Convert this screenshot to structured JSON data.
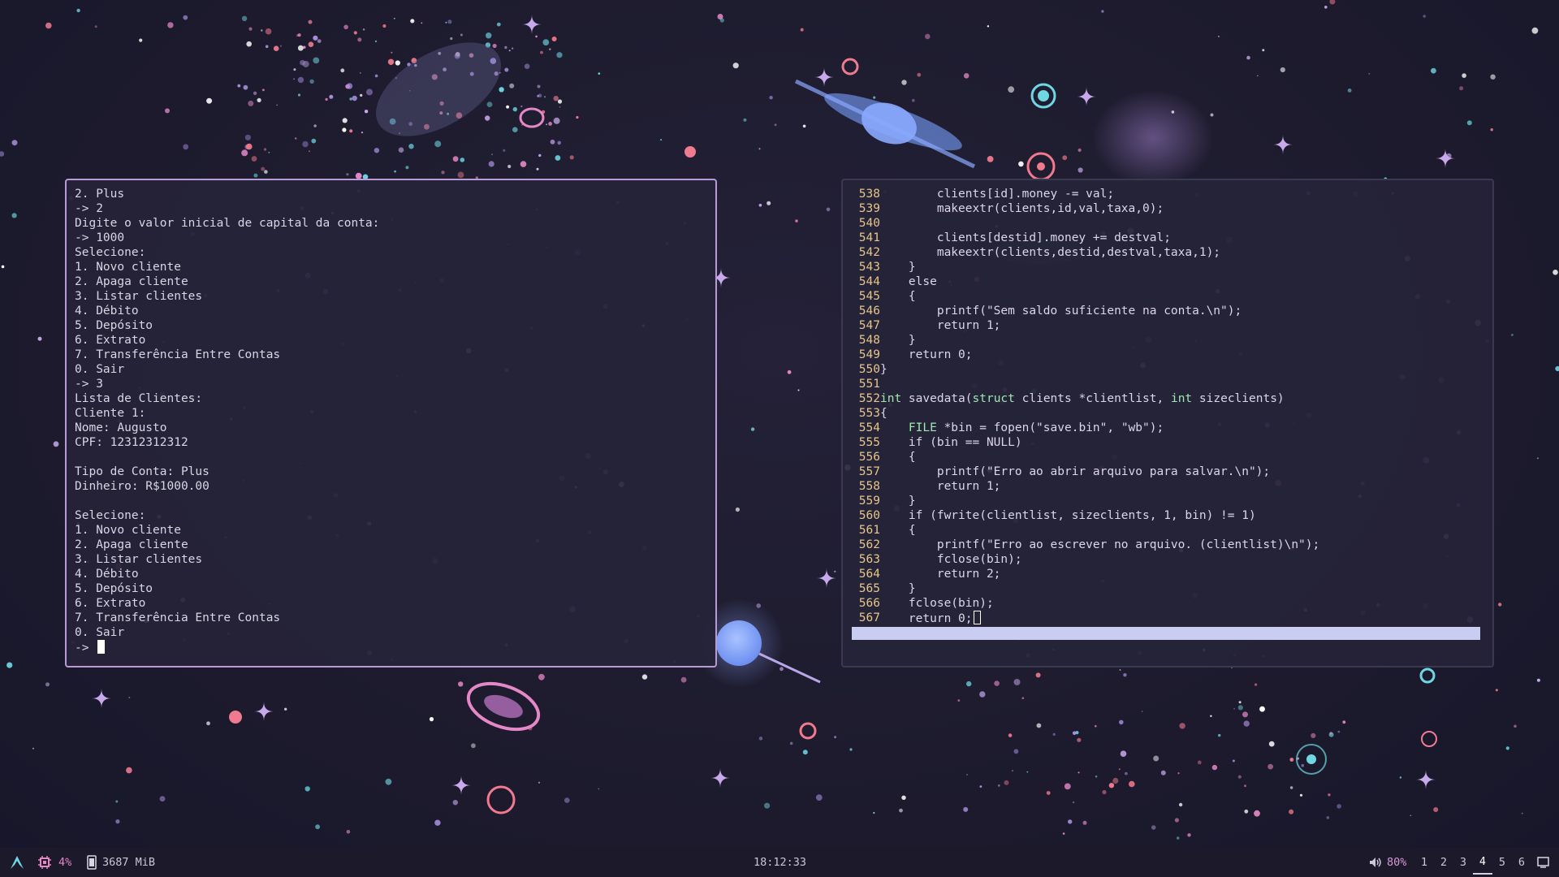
{
  "left_terminal": {
    "lines": [
      "2. Plus",
      "-> 2",
      "Digite o valor inicial de capital da conta:",
      "-> 1000",
      "Selecione:",
      "1. Novo cliente",
      "2. Apaga cliente",
      "3. Listar clientes",
      "4. Débito",
      "5. Depósito",
      "6. Extrato",
      "7. Transferência Entre Contas",
      "0. Sair",
      "-> 3",
      "Lista de Clientes:",
      "Cliente 1:",
      "Nome: Augusto",
      "CPF: 12312312312",
      "",
      "Tipo de Conta: Plus",
      "Dinheiro: R$1000.00",
      "",
      "Selecione:",
      "1. Novo cliente",
      "2. Apaga cliente",
      "3. Listar clientes",
      "4. Débito",
      "5. Depósito",
      "6. Extrato",
      "7. Transferência Entre Contas",
      "0. Sair"
    ],
    "prompt": "-> "
  },
  "right_terminal": {
    "lines": [
      {
        "num": "538",
        "text": "        clients[id].money -= val;"
      },
      {
        "num": "539",
        "text": "        makeextr(clients,id,val,taxa,0);"
      },
      {
        "num": "540",
        "text": ""
      },
      {
        "num": "541",
        "text": "        clients[destid].money += destval;"
      },
      {
        "num": "542",
        "text": "        makeextr(clients,destid,destval,taxa,1);"
      },
      {
        "num": "543",
        "text": "    }"
      },
      {
        "num": "544",
        "text": "    else"
      },
      {
        "num": "545",
        "text": "    {"
      },
      {
        "num": "546",
        "text": "        printf(\"Sem saldo suficiente na conta.\\n\");"
      },
      {
        "num": "547",
        "text": "        return 1;"
      },
      {
        "num": "548",
        "text": "    }"
      },
      {
        "num": "549",
        "text": "    return 0;"
      },
      {
        "num": "550",
        "text": "}"
      },
      {
        "num": "551",
        "text": ""
      },
      {
        "num": "552",
        "text": "int savedata(struct clients *clientlist, int sizeclients)"
      },
      {
        "num": "553",
        "text": "{"
      },
      {
        "num": "554",
        "text": "    FILE *bin = fopen(\"save.bin\", \"wb\");"
      },
      {
        "num": "555",
        "text": "    if (bin == NULL)"
      },
      {
        "num": "556",
        "text": "    {"
      },
      {
        "num": "557",
        "text": "        printf(\"Erro ao abrir arquivo para salvar.\\n\");"
      },
      {
        "num": "558",
        "text": "        return 1;"
      },
      {
        "num": "559",
        "text": "    }"
      },
      {
        "num": "560",
        "text": "    if (fwrite(clientlist, sizeclients, 1, bin) != 1)"
      },
      {
        "num": "561",
        "text": "    {"
      },
      {
        "num": "562",
        "text": "        printf(\"Erro ao escrever no arquivo. (clientlist)\\n\");"
      },
      {
        "num": "563",
        "text": "        fclose(bin);"
      },
      {
        "num": "564",
        "text": "        return 2;"
      },
      {
        "num": "565",
        "text": "    }"
      },
      {
        "num": "566",
        "text": "    fclose(bin);"
      },
      {
        "num": "567",
        "text": "    return 0;"
      }
    ]
  },
  "taskbar": {
    "cpu_percent": "4%",
    "memory": "3687 MiB",
    "clock": "18:12:33",
    "volume": "80%",
    "workspaces": [
      "1",
      "2",
      "3",
      "4",
      "5",
      "6"
    ],
    "active_workspace": "4",
    "icons": [
      "arch-logo-icon",
      "cpu-icon",
      "memory-icon",
      "volume-icon",
      "window-icon"
    ],
    "accent_color": "#b79ad6"
  }
}
